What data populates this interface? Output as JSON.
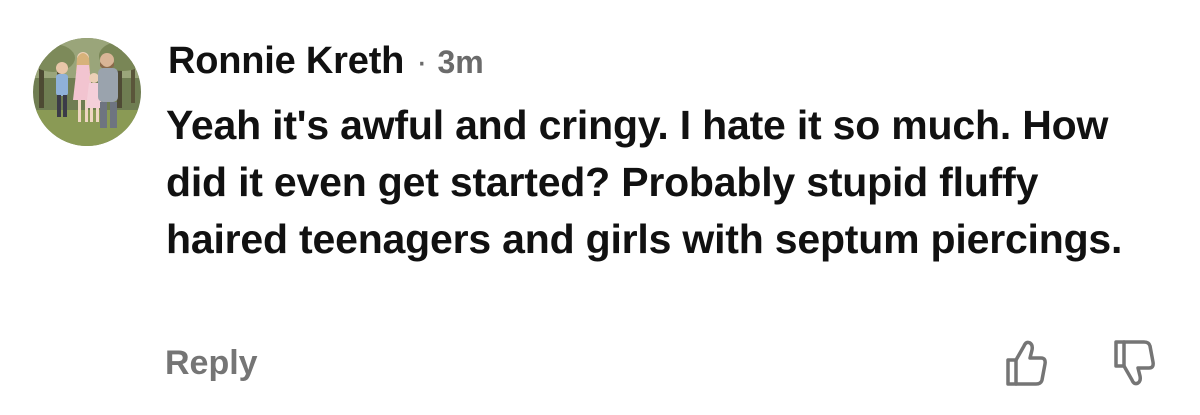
{
  "comment": {
    "author": "Ronnie Kreth",
    "separator": "·",
    "time": "3m",
    "text": "Yeah it's awful and cringy. I hate it so much. How did it even get started? Probably stupid fluffy haired teenagers and girls with septum piercings.",
    "reply_label": "Reply"
  },
  "icons": {
    "avatar": "profile-photo-family",
    "upvote": "thumbs-up-icon",
    "downvote": "thumbs-down-icon"
  },
  "colors": {
    "author": "#111111",
    "meta": "#6b6b6b",
    "reply": "#757575",
    "icon": "#757575"
  }
}
